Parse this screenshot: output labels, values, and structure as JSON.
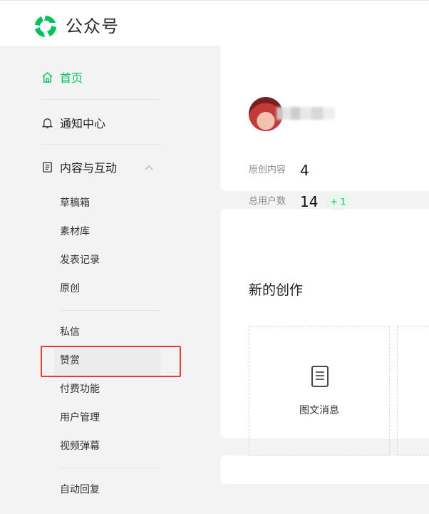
{
  "header": {
    "brand": "公众号",
    "logo_icon": "wechat-mp-logo-icon",
    "accent": "#07c160"
  },
  "sidebar": {
    "home": {
      "label": "首页",
      "icon": "home-icon"
    },
    "notifications": {
      "label": "通知中心",
      "icon": "bell-icon"
    },
    "content": {
      "label": "内容与互动",
      "icon": "document-icon",
      "expanded_icon": "chevron-up-icon"
    },
    "sub_items": [
      {
        "label": "草稿箱"
      },
      {
        "label": "素材库"
      },
      {
        "label": "发表记录"
      },
      {
        "label": "原创"
      },
      {
        "label": "私信"
      },
      {
        "label": "赞赏"
      },
      {
        "label": "付费功能"
      },
      {
        "label": "用户管理"
      },
      {
        "label": "视频弹幕"
      },
      {
        "label": "自动回复"
      }
    ]
  },
  "account": {
    "stats": [
      {
        "label": "原创内容",
        "value": "4"
      },
      {
        "label": "总用户数",
        "value": "14",
        "delta": "+ 1"
      }
    ]
  },
  "create": {
    "title": "新的创作",
    "items": [
      {
        "label": "图文消息",
        "icon": "article-icon"
      }
    ]
  },
  "colors": {
    "highlight_border": "#e53935",
    "page_bg": "#f3f3f3"
  }
}
